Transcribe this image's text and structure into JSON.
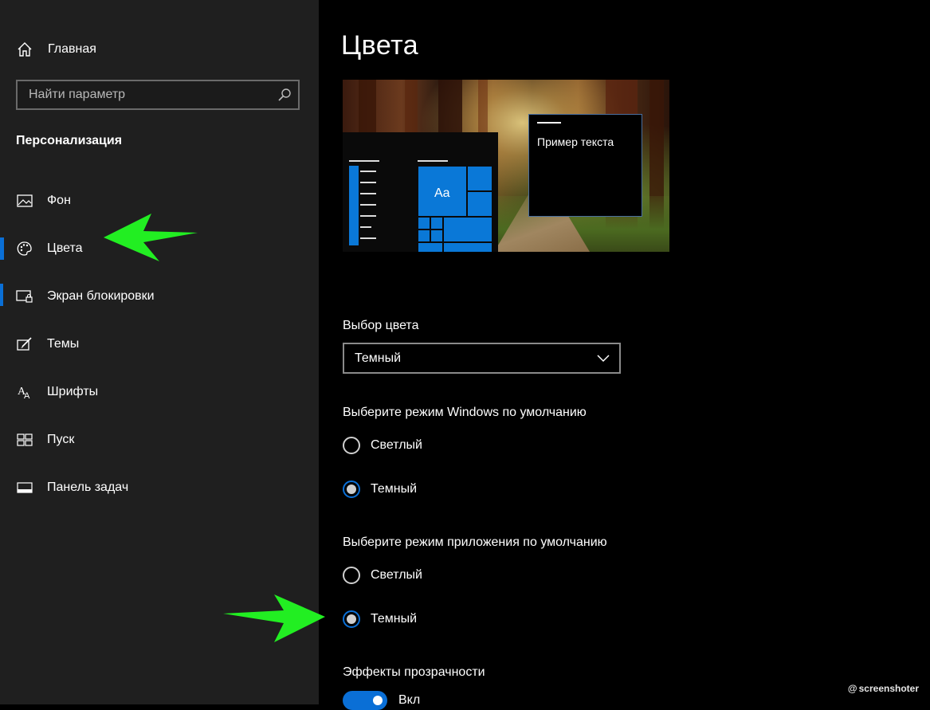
{
  "sidebar": {
    "home_label": "Главная",
    "search_placeholder": "Найти параметр",
    "section_title": "Персонализация",
    "items": [
      {
        "label": "Фон",
        "icon": "picture-icon"
      },
      {
        "label": "Цвета",
        "icon": "palette-icon",
        "active": true
      },
      {
        "label": "Экран блокировки",
        "icon": "lock-screen-icon"
      },
      {
        "label": "Темы",
        "icon": "themes-icon"
      },
      {
        "label": "Шрифты",
        "icon": "fonts-icon"
      },
      {
        "label": "Пуск",
        "icon": "start-icon"
      },
      {
        "label": "Панель задач",
        "icon": "taskbar-icon"
      }
    ]
  },
  "main": {
    "title": "Цвета",
    "preview": {
      "tile_text": "Aa",
      "sample_text": "Пример текста"
    },
    "color_choice": {
      "label": "Выбор цвета",
      "selected": "Темный"
    },
    "windows_mode": {
      "label": "Выберите режим Windows по умолчанию",
      "options": [
        {
          "label": "Светлый",
          "selected": false
        },
        {
          "label": "Темный",
          "selected": true
        }
      ]
    },
    "app_mode": {
      "label": "Выберите режим приложения по умолчанию",
      "options": [
        {
          "label": "Светлый",
          "selected": false
        },
        {
          "label": "Темный",
          "selected": true
        }
      ]
    },
    "transparency": {
      "label": "Эффекты прозрачности",
      "toggle_label": "Вкл",
      "on": true
    }
  },
  "watermark": "screenshoter",
  "colors": {
    "accent": "#0a6fd6",
    "annotation_arrow": "#22ee22"
  }
}
